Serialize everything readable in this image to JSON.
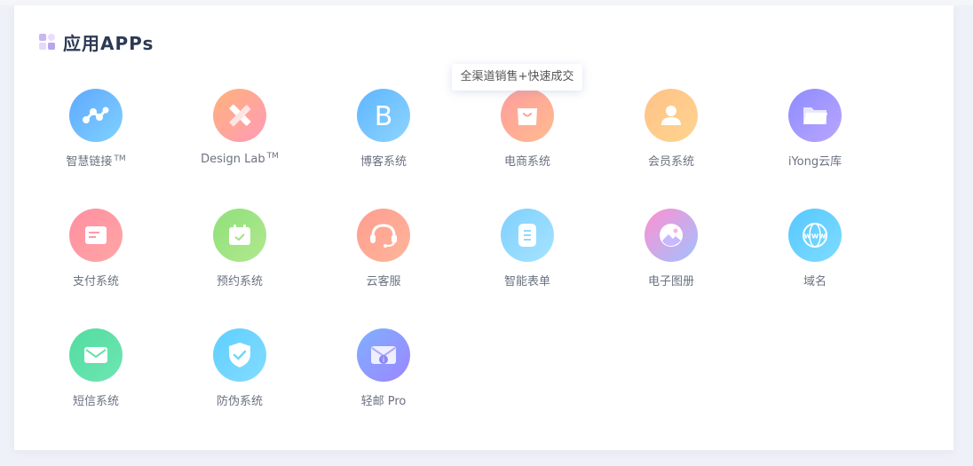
{
  "section": {
    "title": "应用APPs",
    "icon": "app-grid-icon"
  },
  "tooltip": {
    "text": "全渠道销售+快速成交"
  },
  "apps": [
    {
      "label": "智慧链接",
      "tm": "TM",
      "icon": "link-nodes-icon",
      "gradient": [
        "#5fa8ff",
        "#7fd2ff"
      ]
    },
    {
      "label": "Design Lab",
      "tm": "TM",
      "icon": "ruler-pencil-icon",
      "gradient": [
        "#ffb27a",
        "#ff9bb8"
      ]
    },
    {
      "label": "博客系统",
      "tm": "",
      "icon": "letter-b-icon",
      "gradient": [
        "#5db5ff",
        "#8fd5ff"
      ]
    },
    {
      "label": "电商系统",
      "tm": "",
      "icon": "shopping-bag-icon",
      "gradient": [
        "#ff9d9d",
        "#ffbb8f"
      ]
    },
    {
      "label": "会员系统",
      "tm": "",
      "icon": "user-icon",
      "gradient": [
        "#ffc287",
        "#ffd48f"
      ]
    },
    {
      "label": "iYong云库",
      "tm": "",
      "icon": "folder-icon",
      "gradient": [
        "#8e8cff",
        "#b9a6ff"
      ]
    },
    {
      "label": "支付系统",
      "tm": "",
      "icon": "payment-card-icon",
      "gradient": [
        "#ff8fa0",
        "#ffa6a6"
      ]
    },
    {
      "label": "预约系统",
      "tm": "",
      "icon": "calendar-check-icon",
      "gradient": [
        "#8ee07a",
        "#b2e88f"
      ]
    },
    {
      "label": "云客服",
      "tm": "",
      "icon": "headset-icon",
      "gradient": [
        "#ff9d8f",
        "#ffb59b"
      ]
    },
    {
      "label": "智能表单",
      "tm": "",
      "icon": "form-document-icon",
      "gradient": [
        "#7fd0ff",
        "#a6e3ff"
      ]
    },
    {
      "label": "电子图册",
      "tm": "",
      "icon": "photo-album-icon",
      "gradient": [
        "#ff8fd0",
        "#9fc2ff"
      ]
    },
    {
      "label": "域名",
      "tm": "",
      "icon": "globe-www-icon",
      "gradient": [
        "#56c8ff",
        "#7fdcff"
      ]
    },
    {
      "label": "短信系统",
      "tm": "",
      "icon": "envelope-icon",
      "gradient": [
        "#52dca1",
        "#6fe6b2"
      ]
    },
    {
      "label": "防伪系统",
      "tm": "",
      "icon": "shield-check-icon",
      "gradient": [
        "#5ecfff",
        "#84dcff"
      ]
    },
    {
      "label": "轻邮 Pro",
      "tm": "",
      "icon": "mail-info-icon",
      "gradient": [
        "#7fb0ff",
        "#9d86ff"
      ]
    }
  ]
}
